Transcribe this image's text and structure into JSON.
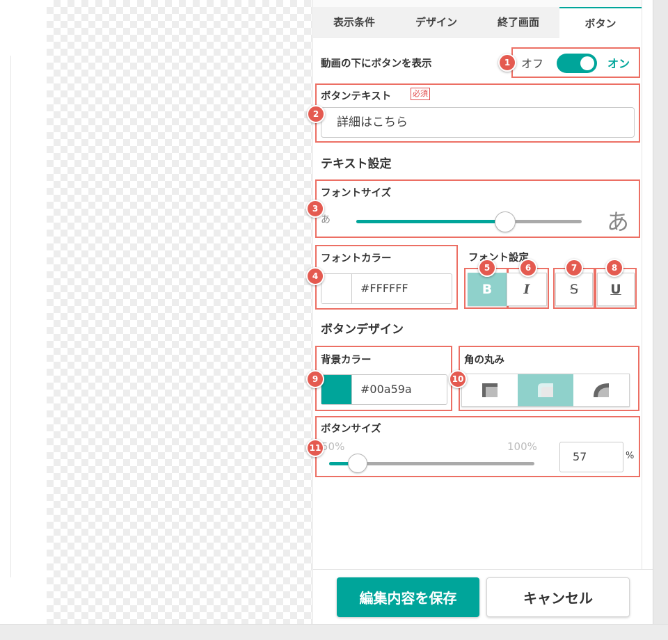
{
  "tabs": [
    {
      "label": "表示条件"
    },
    {
      "label": "デザイン"
    },
    {
      "label": "終了画面"
    },
    {
      "label": "ボタン"
    }
  ],
  "show_button": {
    "label": "動画の下にボタンを表示",
    "off_label": "オフ",
    "on_label": "オン",
    "state": "on"
  },
  "button_text": {
    "label": "ボタンテキスト",
    "required_badge": "必須",
    "value": "詳細はこちら"
  },
  "text_settings": {
    "heading": "テキスト設定",
    "font_size": {
      "label": "フォントサイズ",
      "small_glyph": "あ",
      "large_glyph": "あ",
      "level": 0.66
    },
    "font_color": {
      "label": "フォントカラー",
      "value": "#FFFFFF",
      "swatch": "#FFFFFF"
    },
    "font_style": {
      "label": "フォント設定",
      "buttons": [
        {
          "glyph": "B",
          "name": "bold",
          "active": true
        },
        {
          "glyph": "I",
          "name": "italic",
          "active": false
        },
        {
          "glyph": "S",
          "name": "strikethrough",
          "active": false
        },
        {
          "glyph": "U",
          "name": "underline",
          "active": false
        }
      ]
    }
  },
  "button_design": {
    "heading": "ボタンデザイン",
    "bg_color": {
      "label": "背景カラー",
      "value": "#00a59a",
      "swatch": "#00a59a"
    },
    "corner_radius": {
      "label": "角の丸み",
      "options": [
        "square-corner-icon",
        "rounded-corner-icon",
        "round-corner-icon"
      ],
      "selected": 1
    },
    "button_size": {
      "label": "ボタンサイズ",
      "min_label": "50%",
      "max_label": "100%",
      "value": "57",
      "unit": "%"
    }
  },
  "annotations": [
    "1",
    "2",
    "3",
    "4",
    "5",
    "6",
    "7",
    "8",
    "9",
    "10",
    "11"
  ],
  "footer": {
    "save_label": "編集内容を保存",
    "cancel_label": "キャンセル"
  },
  "colors": {
    "accent": "#00a59a",
    "annotation": "#e45a50",
    "active_toggle": "#8fd1cb"
  }
}
